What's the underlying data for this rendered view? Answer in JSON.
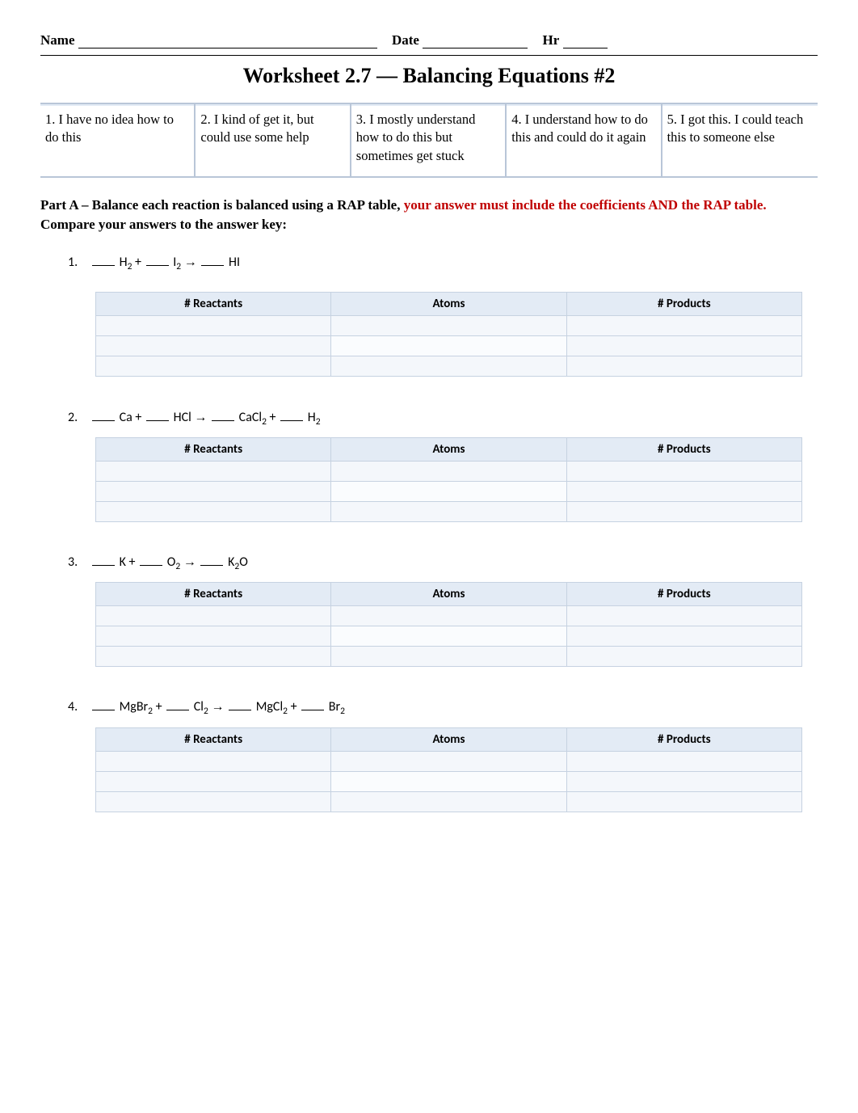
{
  "header": {
    "name_label": "Name",
    "date_label": "Date",
    "hr_label": "Hr"
  },
  "title": "Worksheet 2.7 — Balancing Equations #2",
  "rubric": [
    "1. I have no idea how to do this",
    "2. I kind of get it, but could use some help",
    "3. I mostly understand how to do this but sometimes get stuck",
    "4. I understand how to do this and could do it again",
    "5. I got this. I could teach this to someone else"
  ],
  "partA": {
    "lead": "Part A – ",
    "bold1": "Balance each reaction is balanced using a RAP table, ",
    "red": "your answer must include the coefficients AND the RAP table.",
    "bold2": " Compare your answers to the answer key:"
  },
  "rap_headers": {
    "reactants": "# Reactants",
    "atoms": "Atoms",
    "products": "# Products"
  },
  "equations": [
    {
      "num": "1.",
      "terms": [
        {
          "blank": true
        },
        " H",
        {
          "sub": "2"
        },
        "    +    ",
        {
          "blank": true
        },
        " I",
        {
          "sub": "2"
        },
        "    ",
        {
          "arrow": "→"
        },
        "   ",
        {
          "blank": true
        },
        " HI"
      ]
    },
    {
      "num": "2.",
      "terms": [
        {
          "blank": true
        },
        " Ca     +    ",
        {
          "blank": true
        },
        " HCl ",
        {
          "arrow": "→"
        },
        "     ",
        {
          "blank": true
        },
        " CaCl",
        {
          "sub": "2"
        },
        "     +   ",
        {
          "blank": true
        },
        " H",
        {
          "sub": "2"
        }
      ]
    },
    {
      "num": "3.",
      "terms": [
        {
          "blank": true
        },
        " K    +   ",
        {
          "blank": true
        },
        " O",
        {
          "sub": "2"
        },
        "   ",
        {
          "arrow": "→"
        },
        "    ",
        {
          "blank": true
        },
        " K",
        {
          "sub": "2"
        },
        "O"
      ]
    },
    {
      "num": "4.",
      "terms": [
        {
          "blank": true
        },
        " MgBr",
        {
          "sub": "2"
        },
        "     +   ",
        {
          "blank": true
        },
        " Cl",
        {
          "sub": "2"
        },
        "    ",
        {
          "arrow": "→"
        },
        "    ",
        {
          "blank": true
        },
        " MgCl",
        {
          "sub": "2"
        },
        "  +  ",
        {
          "blank": true
        },
        " Br",
        {
          "sub": "2"
        }
      ]
    }
  ]
}
